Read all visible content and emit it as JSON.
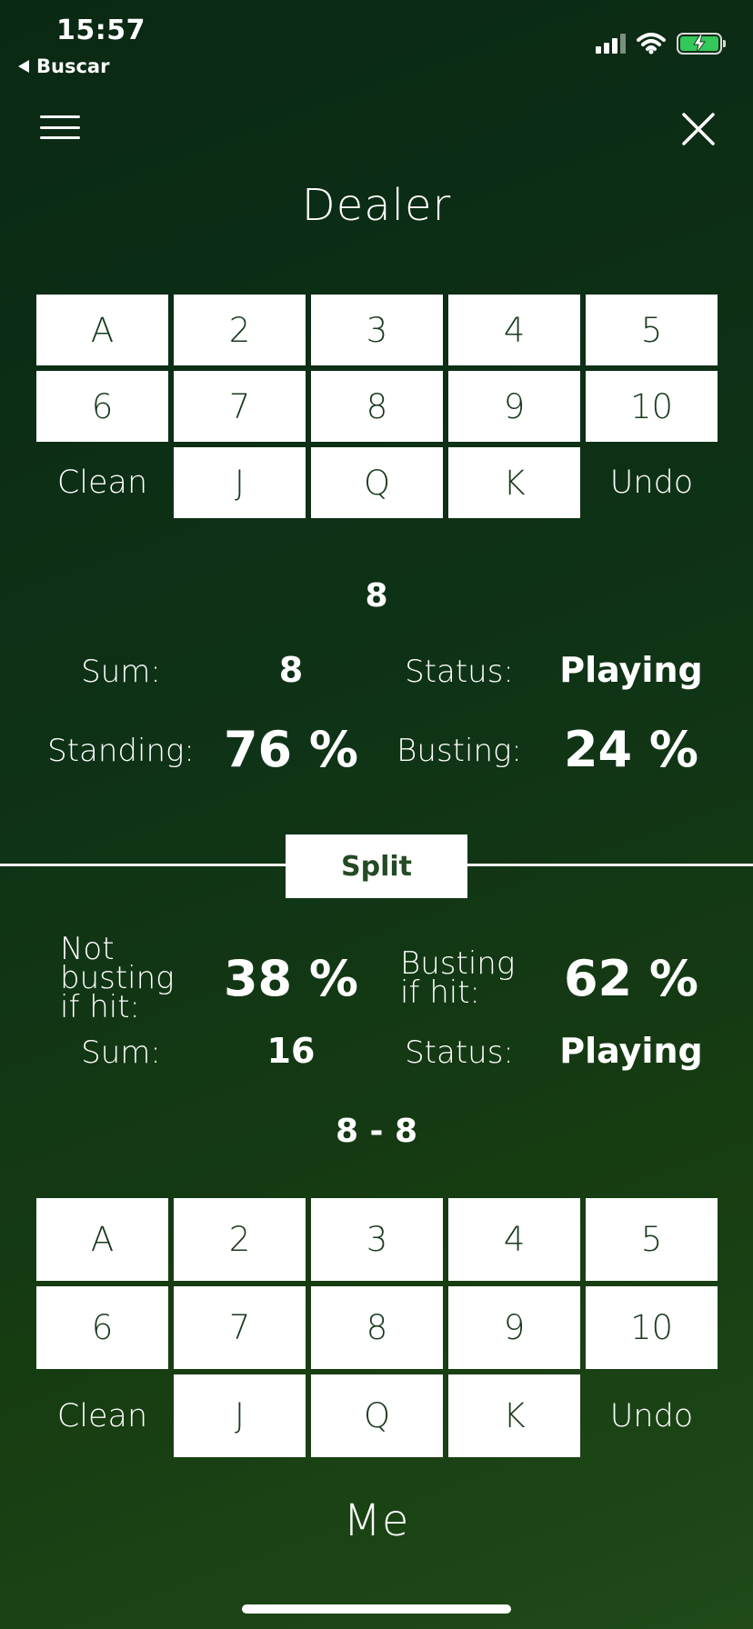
{
  "status_bar": {
    "time": "15:57",
    "back_label": "Buscar",
    "icons": [
      "signal-icon",
      "wifi-icon",
      "battery-charging-icon"
    ]
  },
  "header": {
    "menu_icon": "hamburger-menu-icon",
    "close_icon": "close-icon"
  },
  "dealer": {
    "title": "Dealer",
    "cards": [
      "A",
      "2",
      "3",
      "4",
      "5",
      "6",
      "7",
      "8",
      "9",
      "10"
    ],
    "clean_label": "Clean",
    "face_cards": [
      "J",
      "Q",
      "K"
    ],
    "undo_label": "Undo",
    "hand": "8",
    "sum_label": "Sum:",
    "sum_value": "8",
    "status_label": "Status:",
    "status_value": "Playing",
    "standing_label": "Standing:",
    "standing_value": "76 %",
    "busting_label": "Busting:",
    "busting_value": "24 %"
  },
  "split_label": "Split",
  "me": {
    "not_busting_label": [
      "Not",
      "busting",
      "if hit:"
    ],
    "not_busting_value": "38 %",
    "busting_label": [
      "Busting",
      "if hit:"
    ],
    "busting_value": "62 %",
    "sum_label": "Sum:",
    "sum_value": "16",
    "status_label": "Status:",
    "status_value": "Playing",
    "hand": "8 - 8",
    "cards": [
      "A",
      "2",
      "3",
      "4",
      "5",
      "6",
      "7",
      "8",
      "9",
      "10"
    ],
    "clean_label": "Clean",
    "face_cards": [
      "J",
      "Q",
      "K"
    ],
    "undo_label": "Undo",
    "title": "Me"
  },
  "colors": {
    "background_top": "#0a2914",
    "background_bottom": "#1f4a18",
    "button_bg": "#ffffff",
    "button_text": "#173a1c",
    "battery": "#34c759"
  }
}
